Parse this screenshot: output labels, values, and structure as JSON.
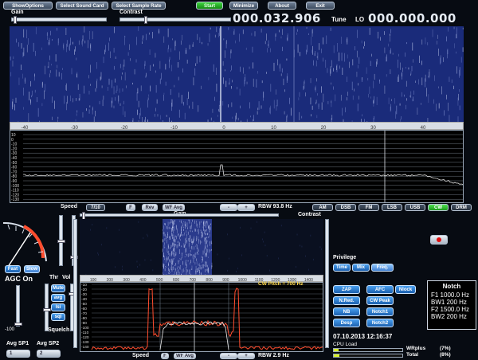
{
  "toolbar": {
    "show_options": "ShowOptions",
    "select_sound_card": "Select Sound Card",
    "select_sample_rate": "Select Sample Rate",
    "start": "Start",
    "minimize": "Minimize",
    "about": "About",
    "exit": "Exit"
  },
  "tune_label": "Tune",
  "lo_label": "LO",
  "tune_freq": "000.032.906",
  "lo_freq": "000.000.000",
  "gain_label": "Gain",
  "contrast_label": "Contrast",
  "top_scale": [
    "-40",
    "-30",
    "-20",
    "-10",
    "0",
    "10",
    "20",
    "30",
    "40"
  ],
  "top_db_labels": [
    "10",
    "0",
    "-10",
    "-20",
    "-30",
    "-40",
    "-50",
    "-60",
    "-70",
    "-80",
    "-90",
    "-100",
    "-110",
    "-120",
    "-130"
  ],
  "speed_bar": {
    "speed_label": "Speed",
    "speed_value": "7/10",
    "f_label": "F",
    "rev_label": "Rev",
    "wf_avg_label": "WF Avg",
    "minus": "-",
    "plus": "+",
    "rbw": "RBW 93.8 Hz"
  },
  "modes": [
    "AM",
    "DSB",
    "FM",
    "LSB",
    "USB",
    "CW",
    "DRM"
  ],
  "active_mode": "CW",
  "agc": {
    "fast": "Fast",
    "slow": "Slow",
    "status": "AGC On",
    "min_label": "-100"
  },
  "thr_label": "Thr",
  "vol_label": "Vol",
  "thr_buttons": [
    "Mute",
    "avg",
    "lsi",
    "sql"
  ],
  "squelch_label": "Squelch",
  "avg_labels": [
    "Avg SP1",
    "Avg SP2"
  ],
  "avg_values": [
    "1",
    "2"
  ],
  "lower": {
    "gain_label": "Gain",
    "contrast_label": "Contrast",
    "scale": [
      "100",
      "200",
      "300",
      "400",
      "500",
      "600",
      "700",
      "800",
      "900",
      "1000",
      "1100",
      "1200",
      "1300",
      "1400"
    ],
    "cw_pitch": "CW Pitch = 700 Hz",
    "db_labels": [
      "-10",
      "-20",
      "-30",
      "-40",
      "-50",
      "-60",
      "-70",
      "-80",
      "-90",
      "-100",
      "-110",
      "-120",
      "-130",
      "-140"
    ]
  },
  "bottom_bar": {
    "speed_label": "Speed",
    "f_label": "F",
    "wf_avg_label": "WF Avg",
    "minus": "-",
    "plus": "+",
    "rbw": "RBW 2.9 Hz"
  },
  "privilege": {
    "label": "Privilege",
    "buttons": [
      "Time",
      "Mix",
      "Freq."
    ]
  },
  "dsp_buttons": [
    "ZAP",
    "AFC",
    "Nlock",
    "N.Red.",
    "CW Peak",
    "NB",
    "Notch1",
    "Desp",
    "Notch2"
  ],
  "notch": {
    "title": "Notch",
    "lines": [
      "F1 1000.0 Hz",
      "BW1 200 Hz",
      "F2 1500.0 Hz",
      "BW2 200 Hz"
    ]
  },
  "datetime": "07.10.2013 12:16:37",
  "cpu_label": "CPU Load",
  "cpu_stats": [
    {
      "name": "WRplus",
      "value": "(7%)"
    },
    {
      "name": "Total",
      "value": "(8%)"
    }
  ],
  "colors": {
    "accent": "#ff4d2e",
    "wf_blue": "#1a2b7a",
    "spectrum_line": "#e0e0e0",
    "active_mode": "#33c433",
    "record": "#e01010"
  }
}
